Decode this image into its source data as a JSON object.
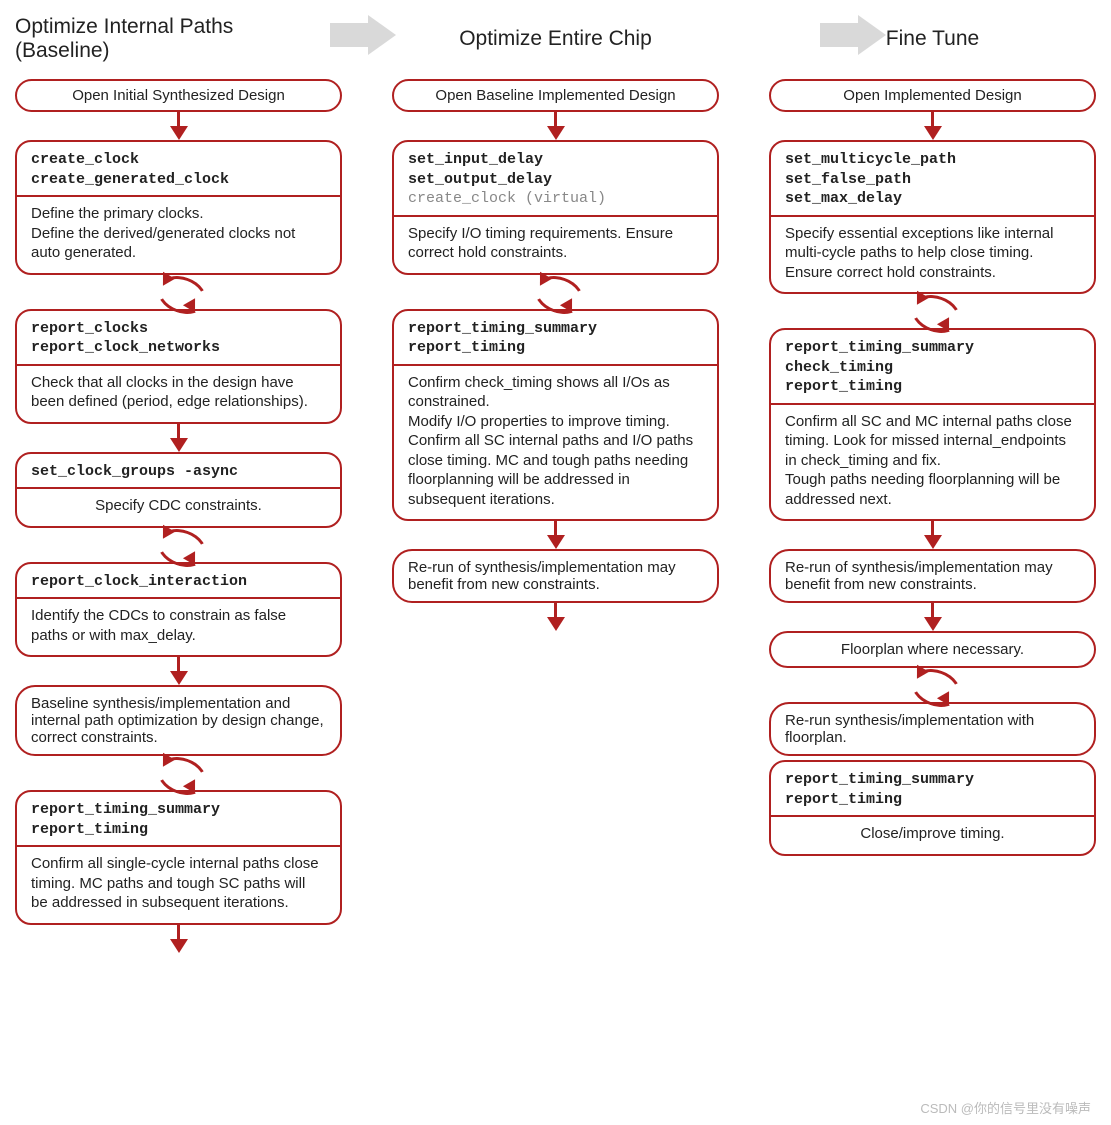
{
  "stage_headings": {
    "col1": "Optimize Internal Paths\n(Baseline)",
    "col2": "Optimize Entire Chip",
    "col3": "Fine Tune"
  },
  "col1": {
    "open": "Open Initial Synthesized Design",
    "b1_head": "create_clock\ncreate_generated_clock",
    "b1_body": "Define the primary clocks.\nDefine the derived/generated clocks not auto generated.",
    "b2_head": "report_clocks\nreport_clock_networks",
    "b2_body": "Check that all clocks in the design have been defined (period, edge relationships).",
    "b3_head": "set_clock_groups -async",
    "b3_body": "Specify CDC constraints.",
    "b4_head": "report_clock_interaction",
    "b4_body": "Identify the CDCs to constrain as false paths or with max_delay.",
    "b5": "Baseline synthesis/implementation and internal path optimization by design change, correct constraints.",
    "b6_head": "report_timing_summary\nreport_timing",
    "b6_body": "Confirm all single-cycle internal paths close timing. MC paths and tough SC paths will be addressed in subsequent iterations."
  },
  "col2": {
    "open": "Open Baseline Implemented Design",
    "b1_head": "set_input_delay\nset_output_delay",
    "b1_head_faded": "create_clock (virtual)",
    "b1_body": "Specify I/O timing requirements. Ensure correct hold constraints.",
    "b2_head": "report_timing_summary\nreport_timing",
    "b2_body": "Confirm check_timing shows all I/Os as constrained.\nModify I/O properties to improve timing.\nConfirm all SC internal paths and I/O paths close timing. MC and tough paths needing floorplanning will be addressed in subsequent iterations.",
    "b3": "Re-run of synthesis/implementation may benefit from new constraints."
  },
  "col3": {
    "open": "Open Implemented Design",
    "b1_head": "set_multicycle_path\nset_false_path\nset_max_delay",
    "b1_body": "Specify essential exceptions like internal multi-cycle paths to help close timing. Ensure correct hold constraints.",
    "b2_head": "report_timing_summary\ncheck_timing\nreport_timing",
    "b2_body": "Confirm all SC and MC internal paths close timing. Look for missed internal_endpoints in check_timing and fix.\nTough paths needing floorplanning will be addressed next.",
    "b3": "Re-run of synthesis/implementation may benefit from new constraints.",
    "b4": "Floorplan where necessary.",
    "b5": "Re-run synthesis/implementation with floorplan.",
    "b6_head": "report_timing_summary\nreport_timing",
    "b6_body": "Close/improve timing."
  },
  "watermark": "CSDN @你的信号里没有噪声"
}
